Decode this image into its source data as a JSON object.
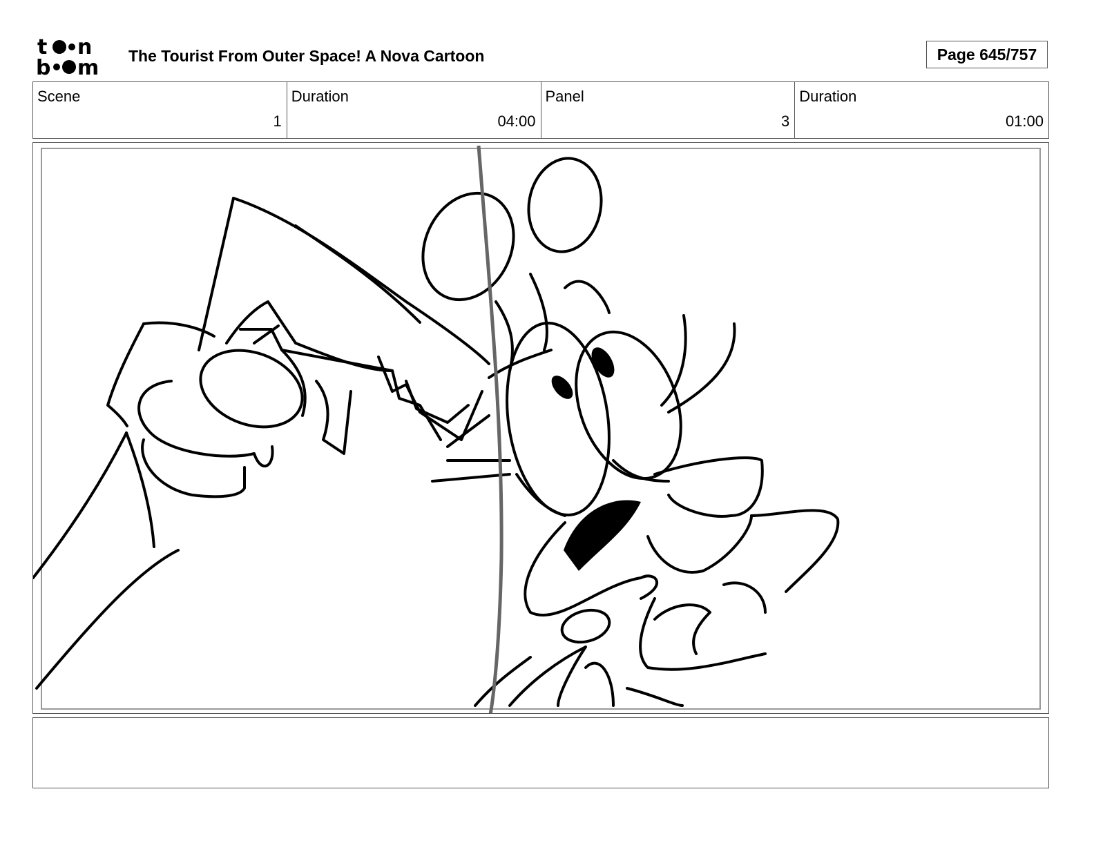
{
  "header": {
    "logo_line1": "t",
    "logo_line1_end": "n",
    "logo_line2": "b",
    "logo_line2_end": "m",
    "title": "The Tourist From Outer Space!  A Nova Cartoon",
    "page_label": "Page 645/757"
  },
  "info": {
    "scene_label": "Scene",
    "scene_value": "1",
    "scene_duration_label": "Duration",
    "scene_duration_value": "04:00",
    "panel_label": "Panel",
    "panel_value": "3",
    "panel_duration_label": "Duration",
    "panel_duration_value": "01:00"
  },
  "panel": {
    "image": "storyboard-sketch-hand-with-ticket-and-surprised-character"
  },
  "notes": {
    "text": ""
  },
  "colors": {
    "ink": "#000000",
    "border": "#555555",
    "guide": "#666666",
    "frame_inner": "#999999"
  }
}
